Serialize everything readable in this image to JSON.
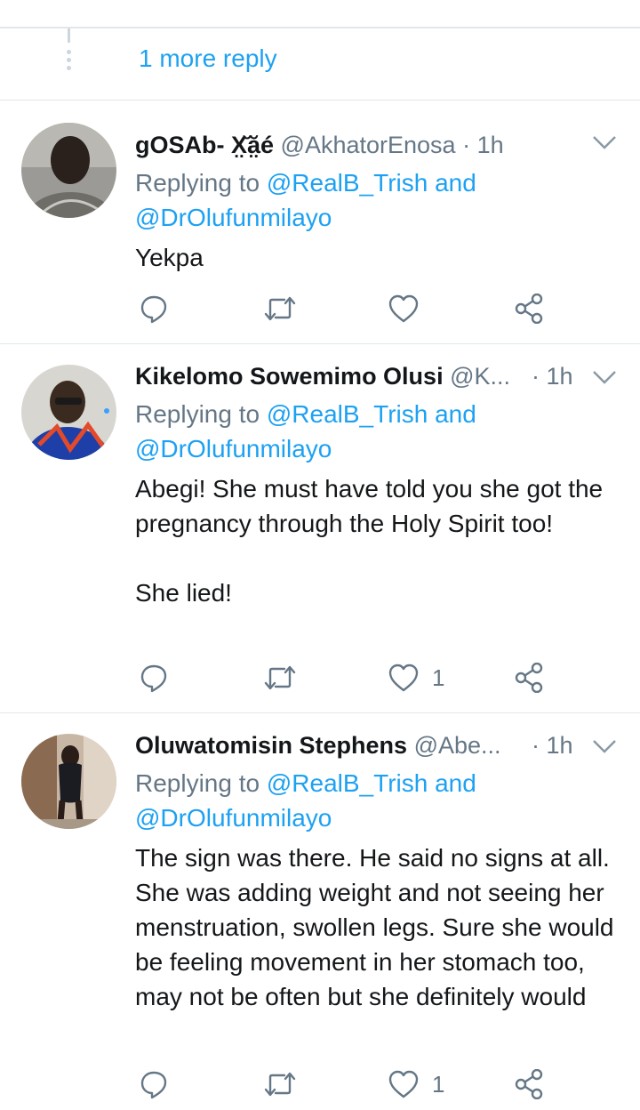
{
  "more_replies": {
    "label": "1 more reply"
  },
  "tweets": [
    {
      "name": "gOSAb- X̤̆ă̤é",
      "handle": "@AkhatorEnosa",
      "time": "· 1h",
      "replying_prefix": "Replying to",
      "replying_to": "@RealB_Trish and",
      "replying_to_2": "@DrOlufunmilayo",
      "text": "Yekpa",
      "likes": ""
    },
    {
      "name": "Kikelomo Sowemimo Olusi",
      "handle": "@K...",
      "time": "· 1h",
      "replying_prefix": "Replying to",
      "replying_to": "@RealB_Trish and",
      "replying_to_2": "@DrOlufunmilayo",
      "text": "Abegi! She must have told you she got the pregnancy through the Holy Spirit too!\n\nShe lied!",
      "likes": "1"
    },
    {
      "name": "Oluwatomisin Stephens",
      "handle": "@Abe...",
      "time": "· 1h",
      "replying_prefix": "Replying to",
      "replying_to": "@RealB_Trish and",
      "replying_to_2": "@DrOlufunmilayo",
      "text": "The sign was there. He said no signs at all. She was adding weight and not seeing her menstruation, swollen legs. Sure she would be feeling movement in her stomach too, may not be often but she definitely would",
      "likes": "1"
    }
  ],
  "colors": {
    "link": "#1da1f2",
    "muted": "#657786",
    "divider": "#e1e8ed"
  },
  "icons": [
    "reply-icon",
    "retweet-icon",
    "like-icon",
    "share-icon",
    "chevron-down-icon"
  ]
}
